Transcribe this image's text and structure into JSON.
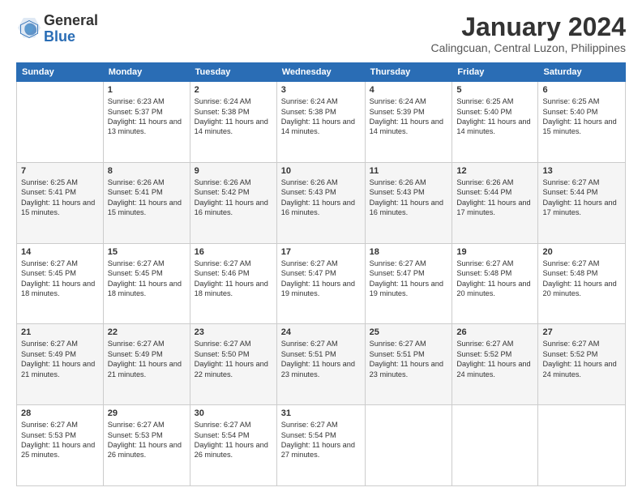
{
  "logo": {
    "general": "General",
    "blue": "Blue"
  },
  "header": {
    "month_year": "January 2024",
    "location": "Calingcuan, Central Luzon, Philippines"
  },
  "days_of_week": [
    "Sunday",
    "Monday",
    "Tuesday",
    "Wednesday",
    "Thursday",
    "Friday",
    "Saturday"
  ],
  "weeks": [
    [
      {
        "day": "",
        "sunrise": "",
        "sunset": "",
        "daylight": ""
      },
      {
        "day": "1",
        "sunrise": "Sunrise: 6:23 AM",
        "sunset": "Sunset: 5:37 PM",
        "daylight": "Daylight: 11 hours and 13 minutes."
      },
      {
        "day": "2",
        "sunrise": "Sunrise: 6:24 AM",
        "sunset": "Sunset: 5:38 PM",
        "daylight": "Daylight: 11 hours and 14 minutes."
      },
      {
        "day": "3",
        "sunrise": "Sunrise: 6:24 AM",
        "sunset": "Sunset: 5:38 PM",
        "daylight": "Daylight: 11 hours and 14 minutes."
      },
      {
        "day": "4",
        "sunrise": "Sunrise: 6:24 AM",
        "sunset": "Sunset: 5:39 PM",
        "daylight": "Daylight: 11 hours and 14 minutes."
      },
      {
        "day": "5",
        "sunrise": "Sunrise: 6:25 AM",
        "sunset": "Sunset: 5:40 PM",
        "daylight": "Daylight: 11 hours and 14 minutes."
      },
      {
        "day": "6",
        "sunrise": "Sunrise: 6:25 AM",
        "sunset": "Sunset: 5:40 PM",
        "daylight": "Daylight: 11 hours and 15 minutes."
      }
    ],
    [
      {
        "day": "7",
        "sunrise": "Sunrise: 6:25 AM",
        "sunset": "Sunset: 5:41 PM",
        "daylight": "Daylight: 11 hours and 15 minutes."
      },
      {
        "day": "8",
        "sunrise": "Sunrise: 6:26 AM",
        "sunset": "Sunset: 5:41 PM",
        "daylight": "Daylight: 11 hours and 15 minutes."
      },
      {
        "day": "9",
        "sunrise": "Sunrise: 6:26 AM",
        "sunset": "Sunset: 5:42 PM",
        "daylight": "Daylight: 11 hours and 16 minutes."
      },
      {
        "day": "10",
        "sunrise": "Sunrise: 6:26 AM",
        "sunset": "Sunset: 5:43 PM",
        "daylight": "Daylight: 11 hours and 16 minutes."
      },
      {
        "day": "11",
        "sunrise": "Sunrise: 6:26 AM",
        "sunset": "Sunset: 5:43 PM",
        "daylight": "Daylight: 11 hours and 16 minutes."
      },
      {
        "day": "12",
        "sunrise": "Sunrise: 6:26 AM",
        "sunset": "Sunset: 5:44 PM",
        "daylight": "Daylight: 11 hours and 17 minutes."
      },
      {
        "day": "13",
        "sunrise": "Sunrise: 6:27 AM",
        "sunset": "Sunset: 5:44 PM",
        "daylight": "Daylight: 11 hours and 17 minutes."
      }
    ],
    [
      {
        "day": "14",
        "sunrise": "Sunrise: 6:27 AM",
        "sunset": "Sunset: 5:45 PM",
        "daylight": "Daylight: 11 hours and 18 minutes."
      },
      {
        "day": "15",
        "sunrise": "Sunrise: 6:27 AM",
        "sunset": "Sunset: 5:45 PM",
        "daylight": "Daylight: 11 hours and 18 minutes."
      },
      {
        "day": "16",
        "sunrise": "Sunrise: 6:27 AM",
        "sunset": "Sunset: 5:46 PM",
        "daylight": "Daylight: 11 hours and 18 minutes."
      },
      {
        "day": "17",
        "sunrise": "Sunrise: 6:27 AM",
        "sunset": "Sunset: 5:47 PM",
        "daylight": "Daylight: 11 hours and 19 minutes."
      },
      {
        "day": "18",
        "sunrise": "Sunrise: 6:27 AM",
        "sunset": "Sunset: 5:47 PM",
        "daylight": "Daylight: 11 hours and 19 minutes."
      },
      {
        "day": "19",
        "sunrise": "Sunrise: 6:27 AM",
        "sunset": "Sunset: 5:48 PM",
        "daylight": "Daylight: 11 hours and 20 minutes."
      },
      {
        "day": "20",
        "sunrise": "Sunrise: 6:27 AM",
        "sunset": "Sunset: 5:48 PM",
        "daylight": "Daylight: 11 hours and 20 minutes."
      }
    ],
    [
      {
        "day": "21",
        "sunrise": "Sunrise: 6:27 AM",
        "sunset": "Sunset: 5:49 PM",
        "daylight": "Daylight: 11 hours and 21 minutes."
      },
      {
        "day": "22",
        "sunrise": "Sunrise: 6:27 AM",
        "sunset": "Sunset: 5:49 PM",
        "daylight": "Daylight: 11 hours and 21 minutes."
      },
      {
        "day": "23",
        "sunrise": "Sunrise: 6:27 AM",
        "sunset": "Sunset: 5:50 PM",
        "daylight": "Daylight: 11 hours and 22 minutes."
      },
      {
        "day": "24",
        "sunrise": "Sunrise: 6:27 AM",
        "sunset": "Sunset: 5:51 PM",
        "daylight": "Daylight: 11 hours and 23 minutes."
      },
      {
        "day": "25",
        "sunrise": "Sunrise: 6:27 AM",
        "sunset": "Sunset: 5:51 PM",
        "daylight": "Daylight: 11 hours and 23 minutes."
      },
      {
        "day": "26",
        "sunrise": "Sunrise: 6:27 AM",
        "sunset": "Sunset: 5:52 PM",
        "daylight": "Daylight: 11 hours and 24 minutes."
      },
      {
        "day": "27",
        "sunrise": "Sunrise: 6:27 AM",
        "sunset": "Sunset: 5:52 PM",
        "daylight": "Daylight: 11 hours and 24 minutes."
      }
    ],
    [
      {
        "day": "28",
        "sunrise": "Sunrise: 6:27 AM",
        "sunset": "Sunset: 5:53 PM",
        "daylight": "Daylight: 11 hours and 25 minutes."
      },
      {
        "day": "29",
        "sunrise": "Sunrise: 6:27 AM",
        "sunset": "Sunset: 5:53 PM",
        "daylight": "Daylight: 11 hours and 26 minutes."
      },
      {
        "day": "30",
        "sunrise": "Sunrise: 6:27 AM",
        "sunset": "Sunset: 5:54 PM",
        "daylight": "Daylight: 11 hours and 26 minutes."
      },
      {
        "day": "31",
        "sunrise": "Sunrise: 6:27 AM",
        "sunset": "Sunset: 5:54 PM",
        "daylight": "Daylight: 11 hours and 27 minutes."
      },
      {
        "day": "",
        "sunrise": "",
        "sunset": "",
        "daylight": ""
      },
      {
        "day": "",
        "sunrise": "",
        "sunset": "",
        "daylight": ""
      },
      {
        "day": "",
        "sunrise": "",
        "sunset": "",
        "daylight": ""
      }
    ]
  ]
}
